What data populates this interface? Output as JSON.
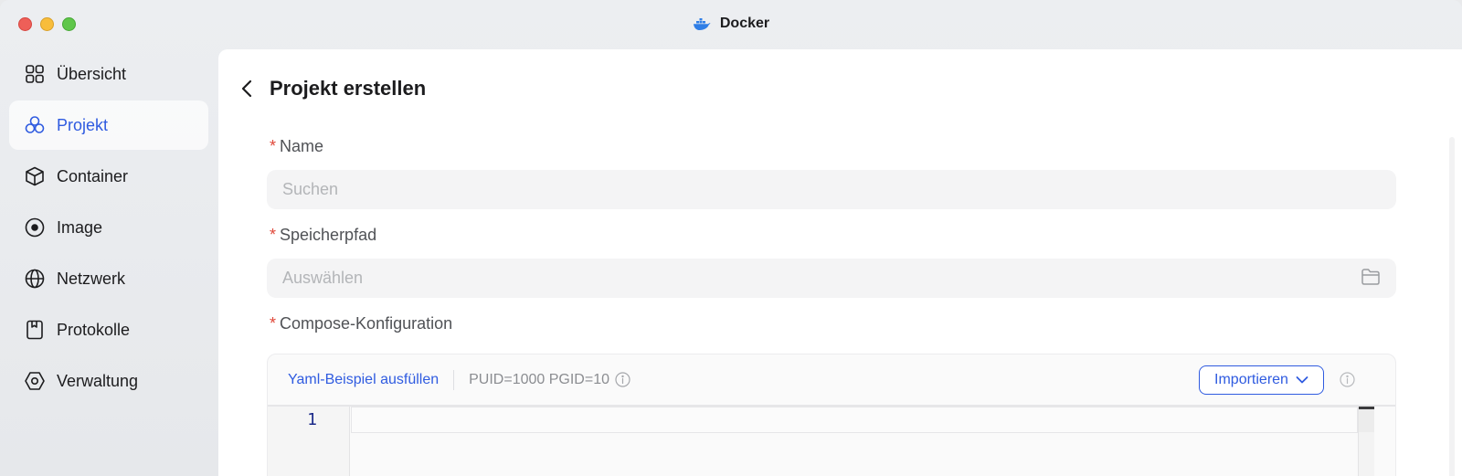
{
  "window": {
    "title": "Docker"
  },
  "sidebar": {
    "items": [
      {
        "label": "Übersicht",
        "icon": "grid-icon",
        "active": false
      },
      {
        "label": "Projekt",
        "icon": "hexagons-icon",
        "active": true
      },
      {
        "label": "Container",
        "icon": "cube-icon",
        "active": false
      },
      {
        "label": "Image",
        "icon": "disc-icon",
        "active": false
      },
      {
        "label": "Netzwerk",
        "icon": "globe-icon",
        "active": false
      },
      {
        "label": "Protokolle",
        "icon": "log-icon",
        "active": false
      },
      {
        "label": "Verwaltung",
        "icon": "settings-hex-icon",
        "active": false
      }
    ]
  },
  "header": {
    "title": "Projekt erstellen"
  },
  "form": {
    "required_marker": "*",
    "name": {
      "label": "Name",
      "value": "",
      "placeholder": "Suchen"
    },
    "path": {
      "label": "Speicherpfad",
      "value": "",
      "placeholder": "Auswählen"
    },
    "compose": {
      "label": "Compose-Konfiguration",
      "yaml_link": "Yaml-Beispiel ausfüllen",
      "env_hint": "PUID=1000 PGID=10",
      "import_label": "Importieren",
      "line_number": "1",
      "code": ""
    }
  },
  "colors": {
    "accent": "#2f5be0",
    "required": "#e0483a"
  }
}
